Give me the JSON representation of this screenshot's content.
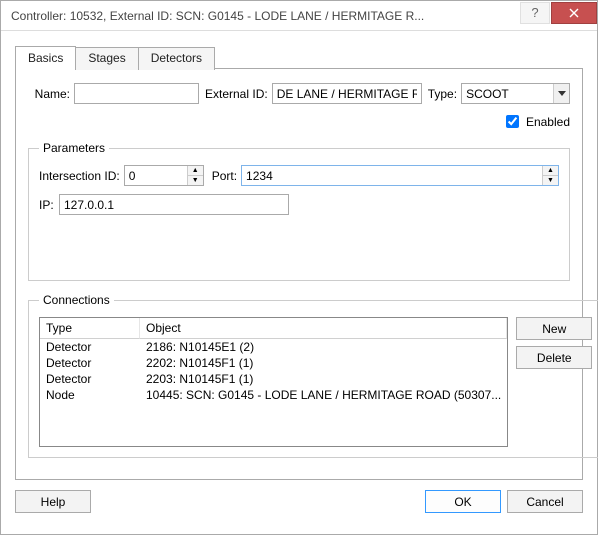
{
  "titlebar": {
    "title": "Controller: 10532, External ID: SCN: G0145 - LODE LANE / HERMITAGE R..."
  },
  "tabs": {
    "basics": "Basics",
    "stages": "Stages",
    "detectors": "Detectors"
  },
  "basics": {
    "name": {
      "label": "Name:",
      "value": ""
    },
    "external_id": {
      "label": "External ID:",
      "value": "DE LANE / HERMITAGE ROAD"
    },
    "type": {
      "label": "Type:",
      "value": "SCOOT"
    },
    "enabled": {
      "label": "Enabled",
      "checked": true
    }
  },
  "parameters": {
    "legend": "Parameters",
    "intersection_id": {
      "label": "Intersection ID:",
      "value": "0"
    },
    "port": {
      "label": "Port:",
      "value": "1234"
    },
    "ip": {
      "label": "IP:",
      "value": "127.0.0.1"
    }
  },
  "connections": {
    "legend": "Connections",
    "columns": {
      "type": "Type",
      "object": "Object"
    },
    "rows": [
      {
        "type": "Detector",
        "object": "2186: N10145E1 (2)"
      },
      {
        "type": "Detector",
        "object": "2202: N10145F1 (1)"
      },
      {
        "type": "Detector",
        "object": "2203: N10145F1 (1)"
      },
      {
        "type": "Node",
        "object": "10445: SCN: G0145 - LODE LANE / HERMITAGE ROAD (50307..."
      }
    ],
    "buttons": {
      "new": "New",
      "delete": "Delete"
    }
  },
  "footer": {
    "help": "Help",
    "ok": "OK",
    "cancel": "Cancel"
  }
}
